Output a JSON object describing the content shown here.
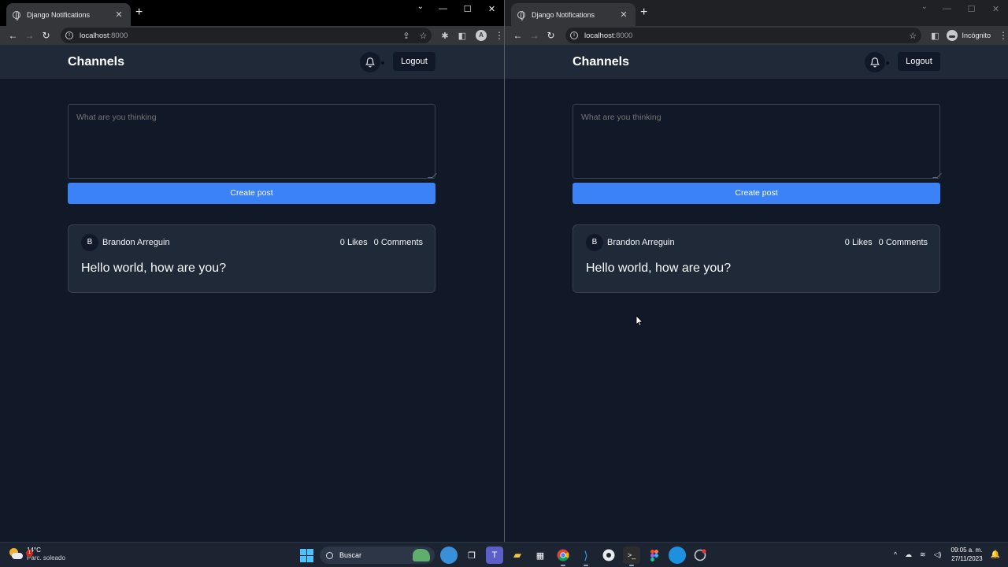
{
  "browser": {
    "tab_title": "Django Notifications",
    "tab_close": "✕",
    "new_tab": "+",
    "url_host": "localhost",
    "url_port": ":8000",
    "incognito_label": "Incógnito",
    "profile_initial": "A"
  },
  "app": {
    "brand": "Channels",
    "logout_label": "Logout",
    "compose_placeholder": "What are you thinking",
    "create_post_label": "Create post",
    "post": {
      "avatar_initial": "B",
      "author": "Brandon Arreguin",
      "likes": "0 Likes",
      "comments": "0 Comments",
      "body": "Hello world, how are you?"
    }
  },
  "taskbar": {
    "weather_temp": "14°C",
    "weather_desc": "Parc. soleado",
    "weather_badge": "1",
    "search_label": "Buscar",
    "time": "09:05 a. m.",
    "date": "27/11/2023"
  },
  "colors": {
    "page_bg": "#111827",
    "header_bg": "#1f2937",
    "accent": "#3b82f6"
  }
}
